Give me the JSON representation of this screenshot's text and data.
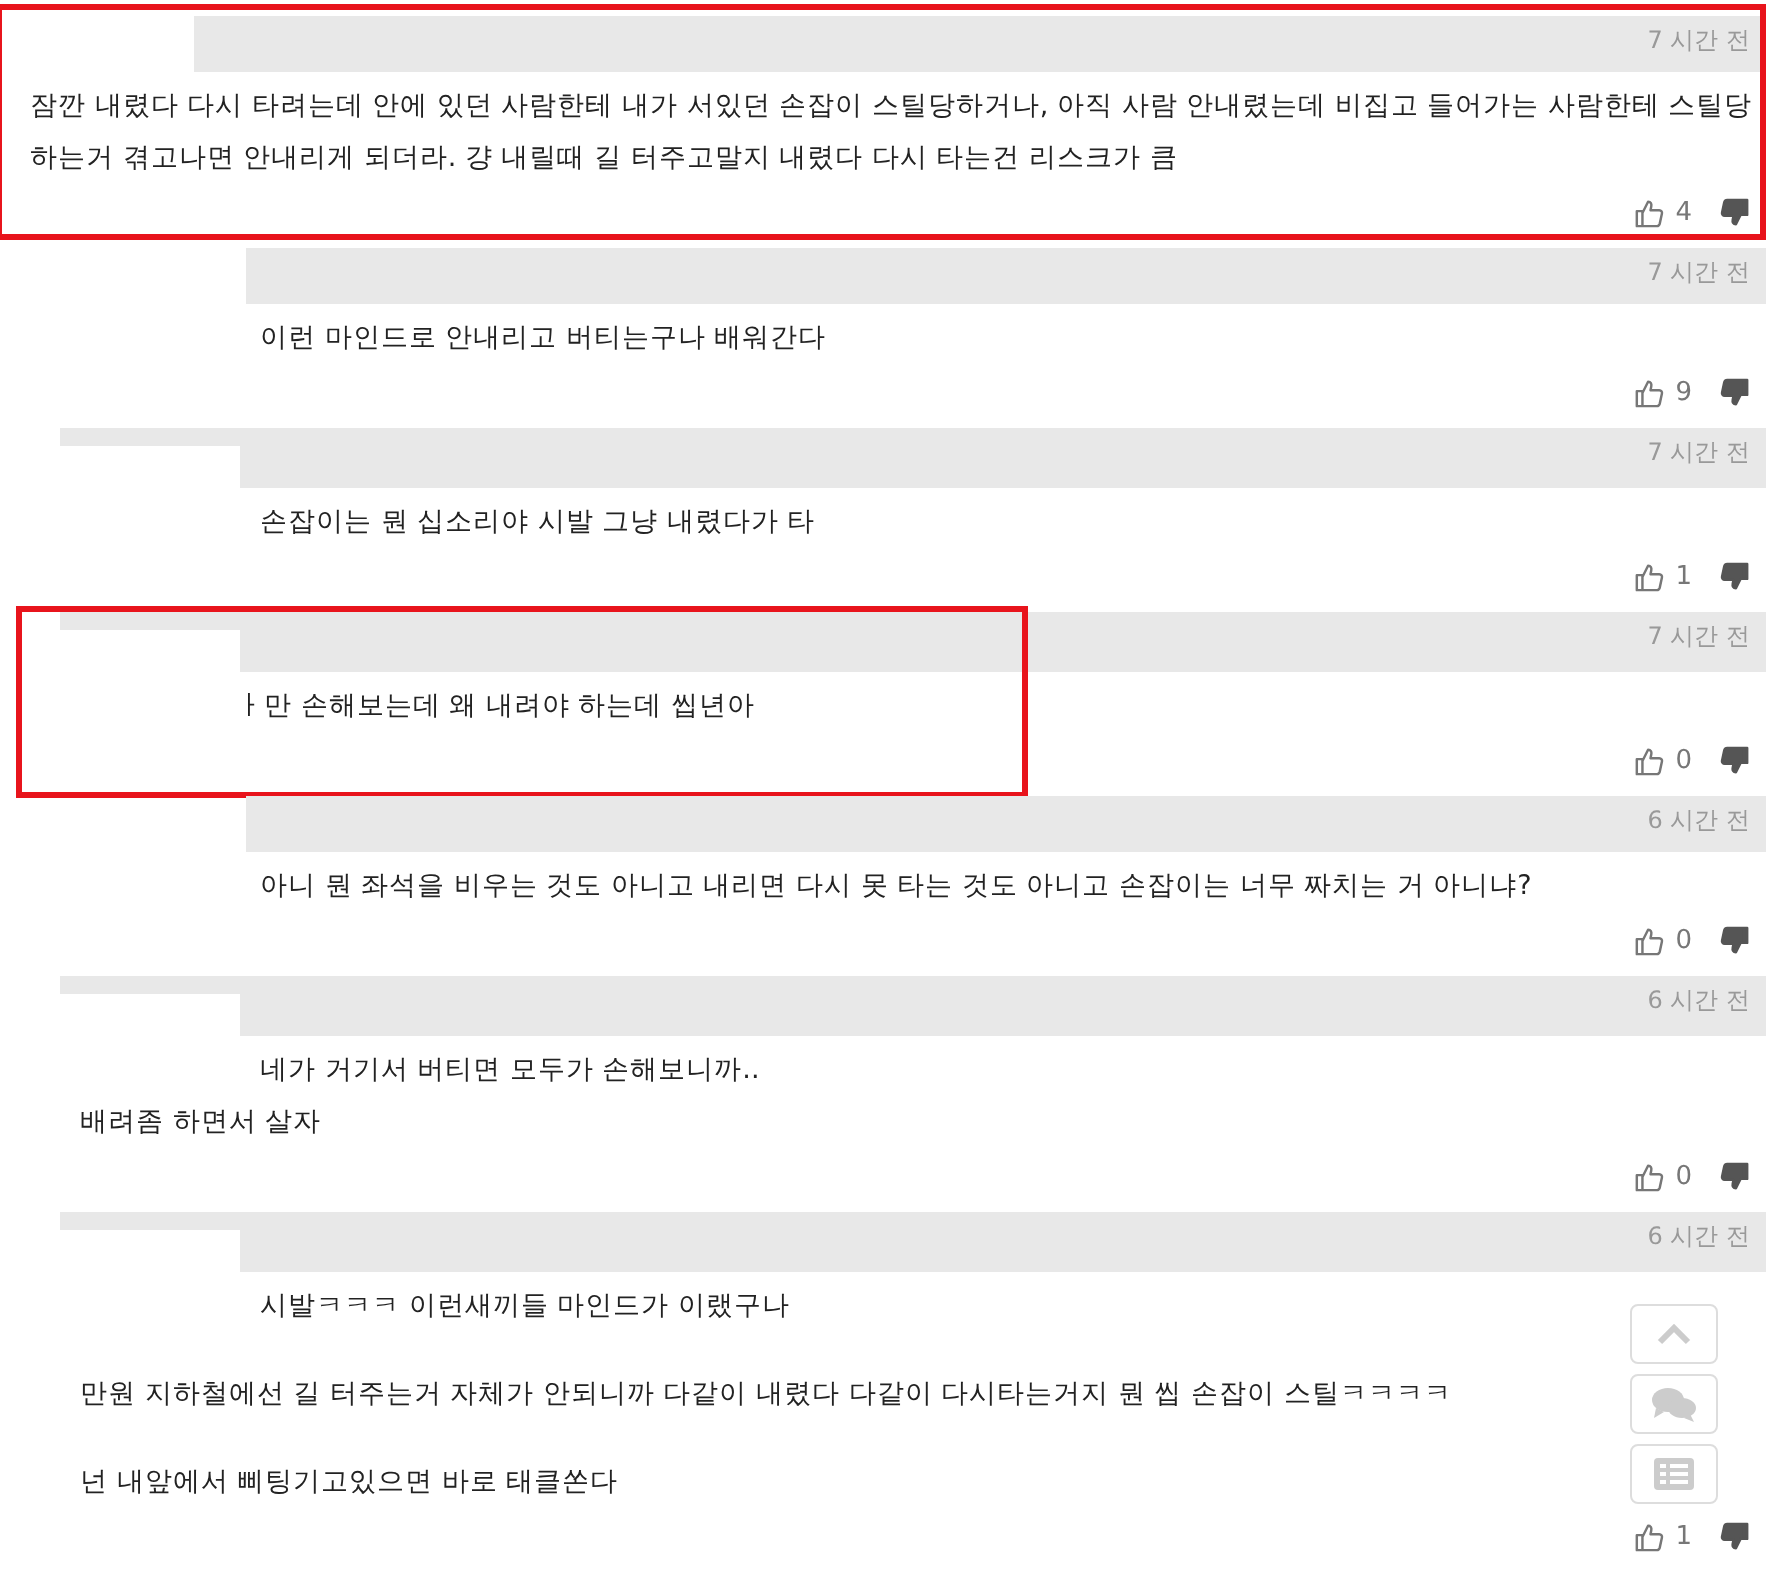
{
  "comments": [
    {
      "kind": "post",
      "highlighted": true,
      "spaced": false,
      "time": "7 시간 전",
      "lines": [
        "잠깐 내렸다 다시 타려는데 안에 있던 사람한테 내가 서있던 손잡이 스틸당하거나, 아직 사람 안내렸는데 비집고 들어가는 사람한테 스틸당",
        "하는거 겪고나면 안내리게 되더라. 걍 내릴때 길 터주고말지 내렸다 다시 타는건 리스크가 큼"
      ],
      "likes": "4"
    },
    {
      "kind": "reply",
      "highlighted": false,
      "time": "7 시간 전",
      "lines": [
        "이런 마인드로 안내리고 버티는구나 배워간다"
      ],
      "likes": "9"
    },
    {
      "kind": "nested",
      "highlighted": false,
      "time": "7 시간 전",
      "lines": [
        "손잡이는 뭔 십소리야 시발 그냥 내렸다가 타"
      ],
      "likes": "1"
    },
    {
      "kind": "nested",
      "highlighted": true,
      "time": "7 시간 전",
      "lines": [
        "ㅏ만 손해보는데 왜 내려야 하는데 씹년아"
      ],
      "likes": "0"
    },
    {
      "kind": "reply",
      "highlighted": false,
      "time": "6 시간 전",
      "lines": [
        "아니 뭔 좌석을 비우는 것도 아니고 내리면 다시 못 타는 것도 아니고 손잡이는 너무 짜치는 거 아니냐?"
      ],
      "likes": "0"
    },
    {
      "kind": "nested",
      "highlighted": false,
      "spaced": false,
      "time": "6 시간 전",
      "lines": [
        "네가 거기서 버티면 모두가 손해보니까..",
        "배려좀 하면서 살자"
      ],
      "likes": "0"
    },
    {
      "kind": "nested",
      "highlighted": false,
      "spaced": true,
      "time": "6 시간 전",
      "lines": [
        "시발ㅋㅋㅋ 이런새끼들 마인드가 이랬구나",
        "만원 지하철에선 길 터주는거 자체가 안되니까 다같이 내렸다 다같이 다시타는거지 뭔 씹 손잡이 스틸ㅋㅋㅋㅋ",
        "넌 내앞에서 삐팅기고있으면 바로 태클쏜다"
      ],
      "likes": "1"
    }
  ]
}
